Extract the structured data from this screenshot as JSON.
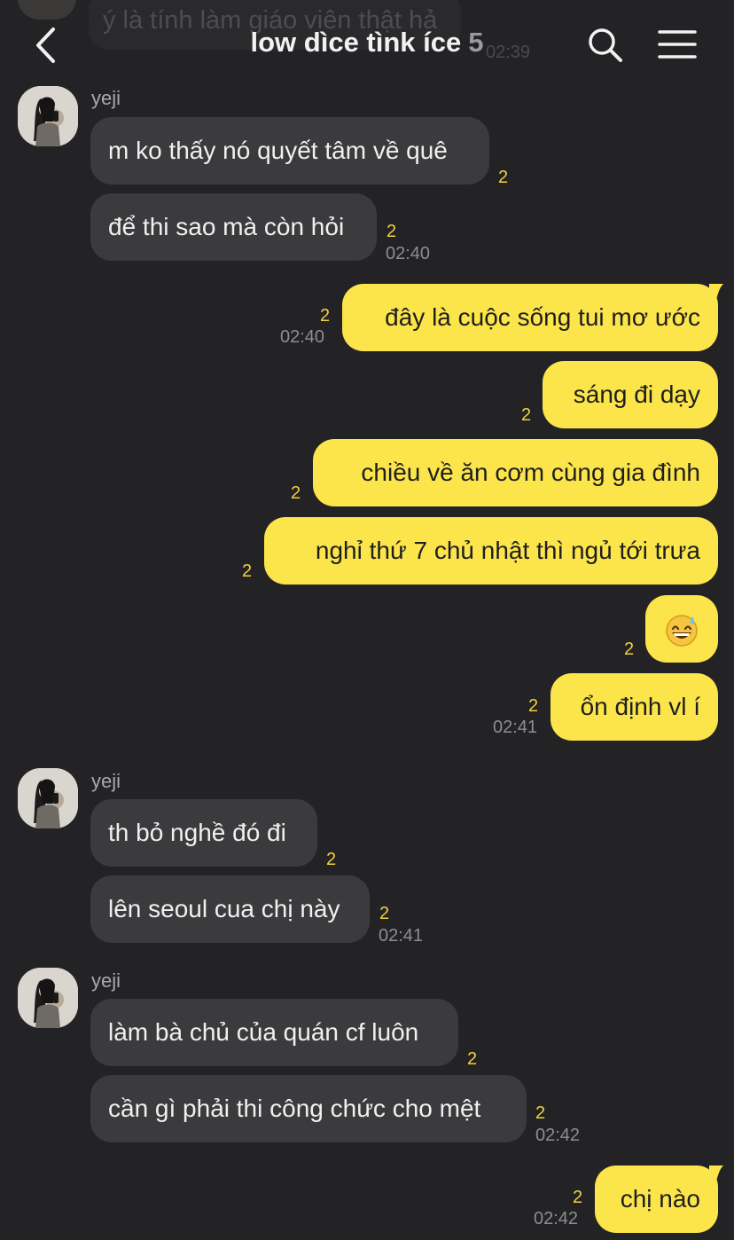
{
  "header": {
    "title": "low dìce tìnk íce",
    "member_count": "5",
    "ghost_message": "ý là tính làm giáo viên thật hả",
    "ghost_time": "02:39"
  },
  "groups": [
    {
      "sender": "yeji",
      "messages": [
        {
          "text": "m ko thấy nó quyết tâm về quê",
          "count": "2",
          "time": ""
        },
        {
          "text": "để thi sao mà còn hỏi",
          "count": "2",
          "time": "02:40"
        }
      ]
    },
    {
      "sender": "me",
      "messages": [
        {
          "text": "đây là cuộc sống tui mơ ước",
          "count": "2",
          "time": "02:40"
        },
        {
          "text": "sáng đi dạy",
          "count": "2",
          "time": ""
        },
        {
          "text": "chiều về ăn cơm cùng gia đình",
          "count": "2",
          "time": ""
        },
        {
          "text": "nghỉ thứ 7 chủ nhật thì ngủ tới trưa",
          "count": "2",
          "time": ""
        },
        {
          "text": "😅",
          "count": "2",
          "time": ""
        },
        {
          "text": "ổn định vl í",
          "count": "2",
          "time": "02:41"
        }
      ]
    },
    {
      "sender": "yeji",
      "messages": [
        {
          "text": "th bỏ nghề đó đi",
          "count": "2",
          "time": ""
        },
        {
          "text": "lên seoul cua chị này",
          "count": "2",
          "time": "02:41"
        }
      ]
    },
    {
      "sender": "yeji",
      "messages": [
        {
          "text": "làm bà chủ của quán cf luôn",
          "count": "2",
          "time": ""
        },
        {
          "text": "cần gì phải thi công chức cho mệt",
          "count": "2",
          "time": "02:42"
        }
      ]
    },
    {
      "sender": "me",
      "messages": [
        {
          "text": "chị nào",
          "count": "2",
          "time": "02:42"
        }
      ]
    }
  ],
  "colors": {
    "background": "#232325",
    "incoming_bubble": "#3b3b3d",
    "outgoing_bubble": "#fce54a",
    "unread_count": "#f2d23c"
  },
  "icons": {
    "back": "chevron-left-icon",
    "search": "search-icon",
    "menu": "hamburger-menu-icon"
  }
}
